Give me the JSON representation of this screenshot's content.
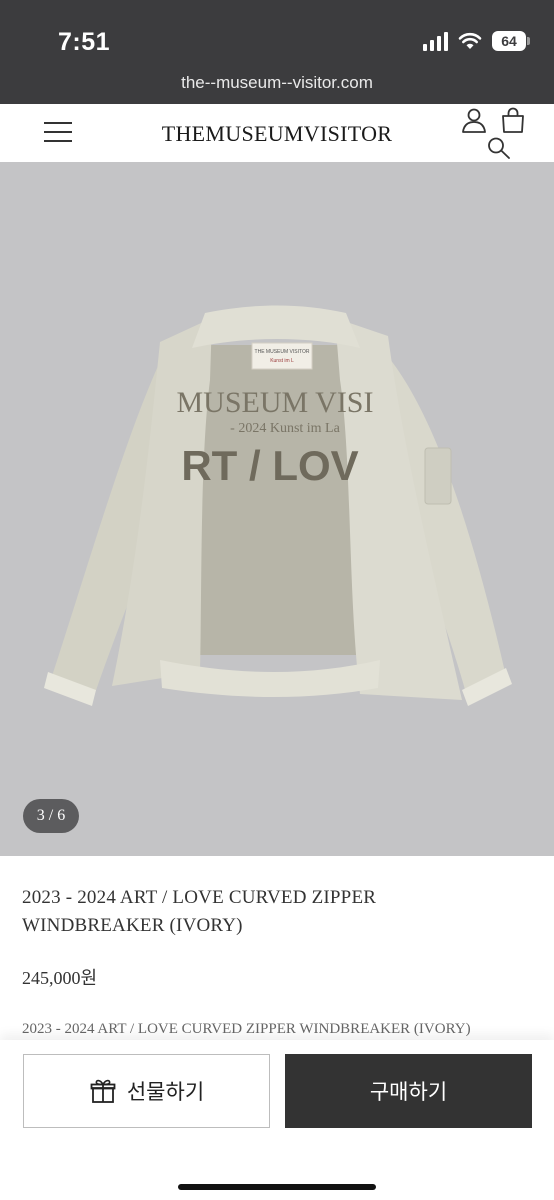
{
  "status": {
    "time": "7:51",
    "battery": "64"
  },
  "browser": {
    "url": "the--museum--visitor.com"
  },
  "header": {
    "brand": "THEMUSEUMVISITOR",
    "icons": [
      "menu-icon",
      "account-icon",
      "cart-icon",
      "search-icon"
    ]
  },
  "gallery": {
    "counter": "3 / 6",
    "current": 3,
    "total": 6,
    "background": "#c4c4c6",
    "jacket_print": {
      "line1": "MUSEUM VISI",
      "line2": "- 2024 Kunst im La",
      "line3": "RT / LOV"
    },
    "label": {
      "line1": "THE MUSEUM VISITOR",
      "line2": "Kunst im L"
    }
  },
  "product": {
    "title": "2023 - 2024 ART / LOVE CURVED ZIPPER WINDBREAKER (IVORY)",
    "price": "245,000원",
    "description": "2023 - 2024 ART / LOVE CURVED ZIPPER WINDBREAKER (IVORY)"
  },
  "actions": {
    "gift_label": "선물하기",
    "buy_label": "구매하기"
  },
  "colors": {
    "topbar": "#3c3c3e",
    "buy_button": "#333333",
    "counter_badge": "#5c5c5e"
  }
}
